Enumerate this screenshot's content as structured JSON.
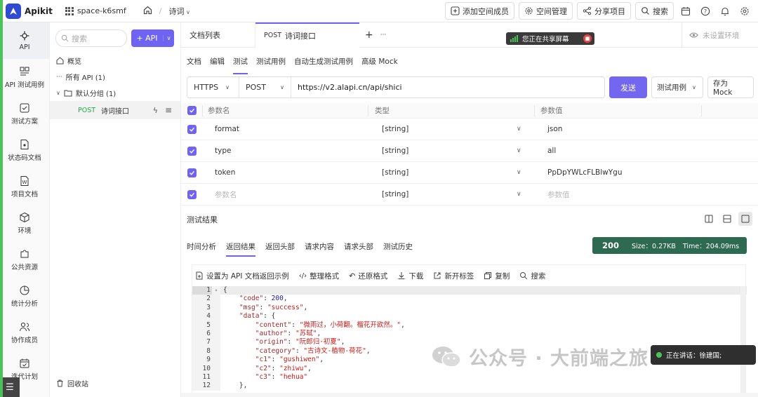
{
  "app": {
    "name": "Apikit",
    "accent": "#6f64f2",
    "logo_color": "#2f4bd3"
  },
  "topbar": {
    "space_name": "space-k6smf",
    "home_icon": "home-icon",
    "breadcrumb": "诗词",
    "buttons": [
      {
        "label": "添加空间成员",
        "icon": "add-user-icon"
      },
      {
        "label": "空间管理",
        "icon": "gear-icon"
      },
      {
        "label": "分享项目",
        "icon": "share-icon"
      },
      {
        "label": "搜索",
        "icon": "search-icon"
      }
    ],
    "icons": [
      "calendar-icon",
      "help-icon",
      "bell-icon",
      "settings-icon"
    ]
  },
  "leftnav": {
    "items": [
      {
        "label": "API",
        "icon": "api-icon",
        "active": true
      },
      {
        "label": "API 测试用例",
        "icon": "test-case-icon"
      },
      {
        "label": "测试方案",
        "icon": "test-plan-icon"
      },
      {
        "label": "状态码文档",
        "icon": "status-doc-icon"
      },
      {
        "label": "项目文档",
        "icon": "project-doc-icon"
      },
      {
        "label": "环境",
        "icon": "environment-icon"
      },
      {
        "label": "公共资源",
        "icon": "puzzle-icon"
      },
      {
        "label": "统计分析",
        "icon": "pie-chart-icon"
      },
      {
        "label": "协作成员",
        "icon": "members-icon"
      },
      {
        "label": "迭代计划",
        "icon": "calendar-check-icon"
      }
    ]
  },
  "tree": {
    "search_placeholder": "搜索",
    "add_api_label": "+ API",
    "overview": "概览",
    "all_api": "所有 API (1)",
    "group": "默认分组 (1)",
    "selected_method": "POST",
    "selected_name": "诗词接口",
    "recycle": "回收站"
  },
  "tabs": {
    "doc_list": "文档列表",
    "active_method": "POST",
    "active_name": "诗词接口",
    "add": "+",
    "more": "···",
    "env_placeholder": "未设置环境"
  },
  "share_banner": "您正在共享屏幕",
  "subtabs": [
    "文档",
    "编辑",
    "测试",
    "测试用例",
    "自动生成测试用例",
    "高级 Mock"
  ],
  "subtab_active": "测试",
  "request": {
    "protocol": "HTTPS",
    "method": "POST",
    "url": "https://v2.alapi.cn/api/shici",
    "send_label": "发送",
    "test_case_label": "测试用例",
    "save_mock_label": "存为 Mock"
  },
  "params": {
    "headers": {
      "name": "参数名",
      "type": "类型",
      "value": "参数值"
    },
    "rows": [
      {
        "name": "format",
        "type": "[string]",
        "value": "json"
      },
      {
        "name": "type",
        "type": "[string]",
        "value": "all"
      },
      {
        "name": "token",
        "type": "[string]",
        "value": "PpDpYWLcFLBlwYgu"
      }
    ],
    "empty_row": {
      "name_placeholder": "参数名",
      "type": "[string]",
      "value_placeholder": "参数值"
    }
  },
  "result": {
    "title": "测试结果",
    "tabs": [
      "时间分析",
      "返回结果",
      "返回头部",
      "请求内容",
      "请求头部",
      "测试历史"
    ],
    "active_tab": "返回结果",
    "status_code": "200",
    "size": "Size：0.27KB",
    "time": "Time：204.09ms",
    "status_color": "#2e6a52",
    "tools": [
      {
        "label": "设置为 API 文档返回示例",
        "icon": "set-example-icon"
      },
      {
        "label": "整理格式",
        "icon": "code-format-icon"
      },
      {
        "label": "还原格式",
        "icon": "undo-icon"
      },
      {
        "label": "下载",
        "icon": "download-icon"
      },
      {
        "label": "新开标签",
        "icon": "open-tab-icon"
      },
      {
        "label": "复制",
        "icon": "copy-icon"
      },
      {
        "label": "搜索",
        "icon": "search-icon"
      }
    ]
  },
  "code": [
    {
      "n": "1",
      "t": "{"
    },
    {
      "n": "2",
      "t": "    \"code\": 200,"
    },
    {
      "n": "3",
      "t": "    \"msg\": \"success\","
    },
    {
      "n": "4",
      "t": "    \"data\": {"
    },
    {
      "n": "5",
      "t": "        \"content\": \"微雨过，小荷翻。榴花开欲然。\","
    },
    {
      "n": "6",
      "t": "        \"author\": \"苏轼\","
    },
    {
      "n": "7",
      "t": "        \"origin\": \"阮郎归·初夏\","
    },
    {
      "n": "8",
      "t": "        \"category\": \"古诗文-植物-荷花\","
    },
    {
      "n": "9",
      "t": "        \"c1\": \"gushiwen\","
    },
    {
      "n": "10",
      "t": "        \"c2\": \"zhiwu\","
    },
    {
      "n": "11",
      "t": "        \"c3\": \"hehua\""
    },
    {
      "n": "12",
      "t": "    },"
    }
  ],
  "watermark": "公众号 · 大前端之旅",
  "speaking": "正在讲话：徐建国;"
}
